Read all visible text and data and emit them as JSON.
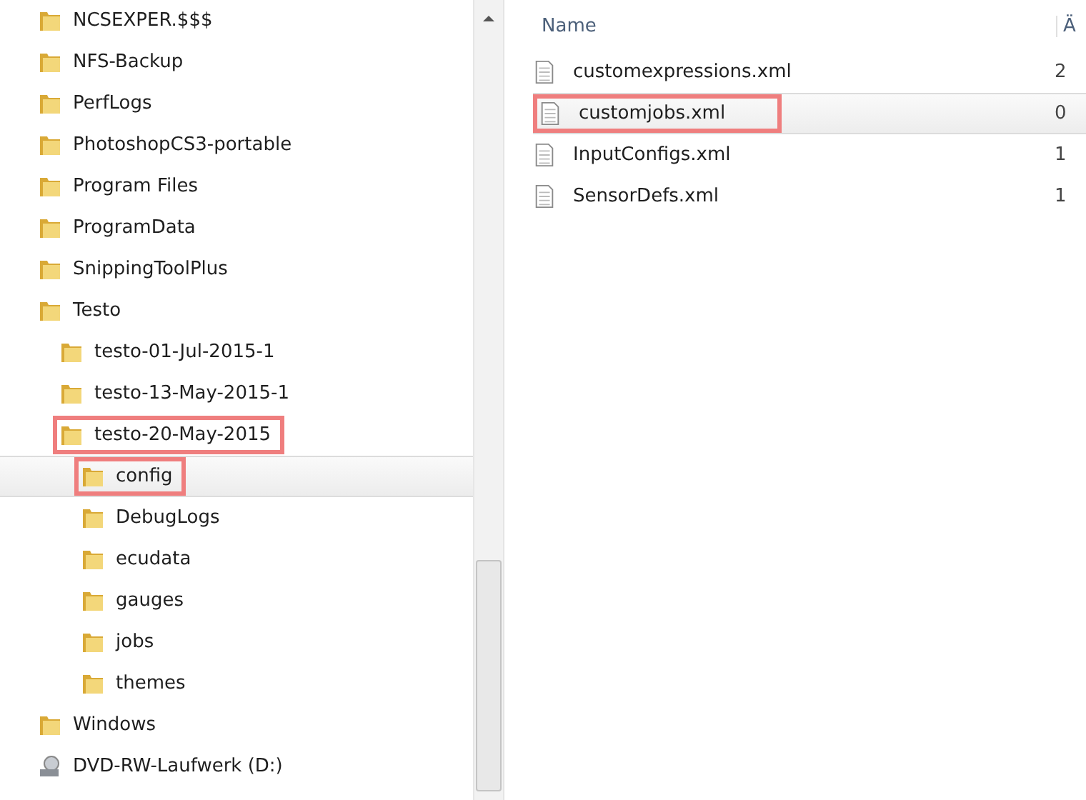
{
  "tree": [
    {
      "label": "NCSEXPER.$$$",
      "kind": "folder",
      "selected": false,
      "marked": false
    },
    {
      "label": "NFS-Backup",
      "kind": "folder",
      "selected": false,
      "marked": false
    },
    {
      "label": "PerfLogs",
      "kind": "folder",
      "selected": false,
      "marked": false
    },
    {
      "label": "PhotoshopCS3-portable",
      "kind": "folder",
      "selected": false,
      "marked": false
    },
    {
      "label": "Program Files",
      "kind": "folder",
      "selected": false,
      "marked": false
    },
    {
      "label": "ProgramData",
      "kind": "folder",
      "selected": false,
      "marked": false
    },
    {
      "label": "SnippingToolPlus",
      "kind": "folder",
      "selected": false,
      "marked": false
    },
    {
      "label": "Testo",
      "kind": "folder",
      "selected": false,
      "marked": false,
      "children": [
        {
          "label": "testo-01-Jul-2015-1",
          "kind": "folder",
          "selected": false,
          "marked": false
        },
        {
          "label": "testo-13-May-2015-1",
          "kind": "folder",
          "selected": false,
          "marked": false
        },
        {
          "label": "testo-20-May-2015",
          "kind": "folder",
          "selected": false,
          "marked": true,
          "children": [
            {
              "label": "config",
              "kind": "folder",
              "selected": true,
              "marked": true
            },
            {
              "label": "DebugLogs",
              "kind": "folder",
              "selected": false,
              "marked": false
            },
            {
              "label": "ecudata",
              "kind": "folder",
              "selected": false,
              "marked": false
            },
            {
              "label": "gauges",
              "kind": "folder",
              "selected": false,
              "marked": false
            },
            {
              "label": "jobs",
              "kind": "folder",
              "selected": false,
              "marked": false
            },
            {
              "label": "themes",
              "kind": "folder",
              "selected": false,
              "marked": false
            }
          ]
        }
      ]
    },
    {
      "label": "Windows",
      "kind": "folder",
      "selected": false,
      "marked": false
    },
    {
      "label": "DVD-RW-Laufwerk (D:)",
      "kind": "drive",
      "selected": false,
      "marked": false
    }
  ],
  "file_list": {
    "columns": [
      "Name",
      "Ä"
    ],
    "rows": [
      {
        "name": "customexpressions.xml",
        "column_2": "2",
        "selected": false,
        "marked": false
      },
      {
        "name": "customjobs.xml",
        "column_2": "0",
        "selected": true,
        "marked": true
      },
      {
        "name": "InputConfigs.xml",
        "column_2": "1",
        "selected": false,
        "marked": false
      },
      {
        "name": "SensorDefs.xml",
        "column_2": "1",
        "selected": false,
        "marked": false
      }
    ]
  }
}
